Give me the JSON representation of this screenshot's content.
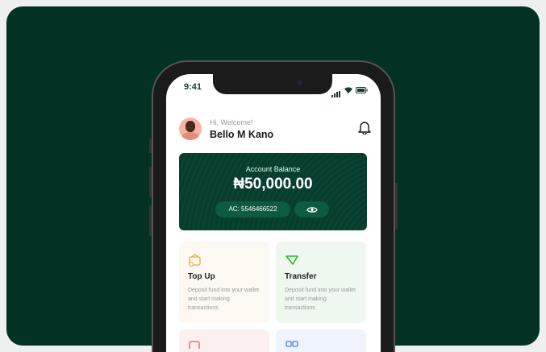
{
  "status_bar": {
    "time": "9:41"
  },
  "header": {
    "greeting": "Hi, Welcome!",
    "user_name": "Bello M Kano"
  },
  "balance_card": {
    "label": "Account Balance",
    "amount": "₦50,000.00",
    "account": "AC: 5546466522"
  },
  "actions": [
    {
      "title": "Top Up",
      "description": "Deposit fund into your wallet and start making transactions",
      "bg": "#fdf9f2",
      "icon_color": "#e9a93b"
    },
    {
      "title": "Transfer",
      "description": "Deposit fund into your wallet and start making transactions",
      "bg": "#eef8ee",
      "icon_color": "#2fb52f"
    },
    {
      "bg": "#fcefef",
      "icon_color": "#e05a5a"
    },
    {
      "bg": "#eef3fc",
      "icon_color": "#4a7fe0"
    }
  ]
}
